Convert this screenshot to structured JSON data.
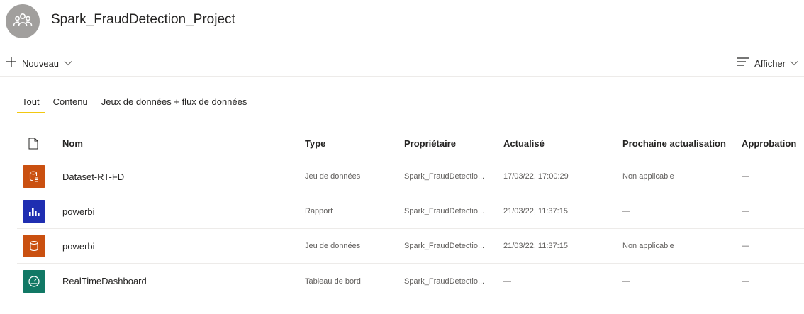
{
  "workspace": {
    "title": "Spark_FraudDetection_Project",
    "avatar_icon": "workspace-people-icon"
  },
  "command_bar": {
    "new_label": "Nouveau",
    "view_label": "Afficher"
  },
  "tabs": [
    {
      "label": "Tout",
      "active": true
    },
    {
      "label": "Contenu",
      "active": false
    },
    {
      "label": "Jeux de données + flux de données",
      "active": false
    }
  ],
  "table": {
    "columns": {
      "name": "Nom",
      "type": "Type",
      "owner": "Propriétaire",
      "updated": "Actualisé",
      "next_refresh": "Prochaine actualisation",
      "approval": "Approbation"
    },
    "rows": [
      {
        "icon": "streaming-dataset-icon",
        "icon_color": "#ca5010",
        "name": "Dataset-RT-FD",
        "type": "Jeu de données",
        "owner": "Spark_FraudDetectio...",
        "updated": "17/03/22, 17:00:29",
        "next_refresh": "Non applicable",
        "approval": "—"
      },
      {
        "icon": "report-icon",
        "icon_color": "#1f2eb1",
        "name": "powerbi",
        "type": "Rapport",
        "owner": "Spark_FraudDetectio...",
        "updated": "21/03/22, 11:37:15",
        "next_refresh": "—",
        "approval": "—"
      },
      {
        "icon": "dataset-icon",
        "icon_color": "#ca5010",
        "name": "powerbi",
        "type": "Jeu de données",
        "owner": "Spark_FraudDetectio...",
        "updated": "21/03/22, 11:37:15",
        "next_refresh": "Non applicable",
        "approval": "—"
      },
      {
        "icon": "dashboard-icon",
        "icon_color": "#117865",
        "name": "RealTimeDashboard",
        "type": "Tableau de bord",
        "owner": "Spark_FraudDetectio...",
        "updated": "—",
        "next_refresh": "—",
        "approval": "—"
      }
    ]
  }
}
